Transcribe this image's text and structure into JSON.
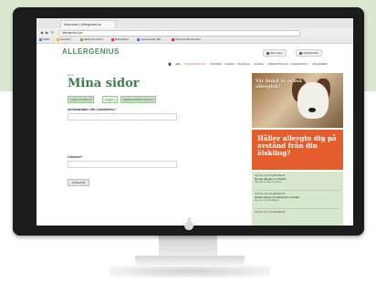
{
  "browser": {
    "tab_title": "Mina sidor | Allergenius.se",
    "url": "allergenius.se/...",
    "bookmarks": [
      "Suffix",
      "Favoriter",
      "Skapa Kontoret",
      "Bokmärken",
      "Importerade från...",
      "Pinterest Bookmarks"
    ]
  },
  "site": {
    "logo_text": "ALLERGENIUS",
    "header_buttons": [
      "Mina sidor",
      "VARUKORG"
    ],
    "nav": [
      "HEM",
      "TRÄNINGSKÄLLOR",
      "FÖR BARN",
      "ALLERGI",
      "TILLFÄLLE",
      "ALLERGI",
      "PRODUKTKALKYL",
      "ALLERGIFAKTA",
      "VÄLKOMMEN"
    ]
  },
  "main": {
    "breadcrumb": "Hem",
    "title": "Mina sidor",
    "tabs": [
      "Logga in/registrera",
      "Logga in",
      "Registrera/Glömt lösenord"
    ],
    "email_label": "Användarnamn eller e-postadress *",
    "password_label": "Lösenord *",
    "login_button": "LOGGA IN"
  },
  "sidebar": {
    "dog_ad_text": "Vår hund är också allergisk?",
    "orange_ad_text": "Håller allergin dig på avstånd från din älskling?",
    "news": [
      {
        "date": "2013-01-10 | ALLERGENIUS",
        "title": "Nu ska allergin in i hälsan",
        "sub": "Här kan du läsa om allergi"
      },
      {
        "date": "2013-01-15 | ALLERGENIUS",
        "title": "Hunde allergi och allergi hos hunden",
        "sub": "Läs mer om hundallergi"
      },
      {
        "date": "2013-01-20 | ALLERGENIUS",
        "title": "",
        "sub": ""
      }
    ]
  },
  "colors": {
    "brand_green": "#3f7b4a",
    "accent_orange": "#e45e2d",
    "sidebar_green": "#d6e7ce",
    "panel_green": "#dbe8cf"
  }
}
